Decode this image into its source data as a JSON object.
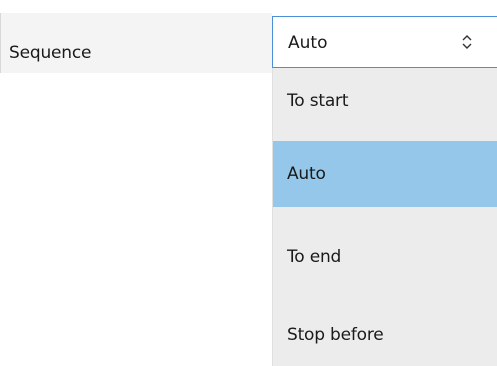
{
  "property": {
    "label": "Sequence"
  },
  "select": {
    "current_value": "Auto",
    "arrow_icon": "updown-chevron-icon"
  },
  "dropdown": {
    "options": [
      {
        "label": "To start",
        "selected": false
      },
      {
        "label": "Auto",
        "selected": true
      },
      {
        "label": "To end",
        "selected": false
      },
      {
        "label": "Stop before",
        "selected": false
      }
    ]
  },
  "colors": {
    "selected_highlight": "#94c7ea",
    "focus_border": "#4a90d9",
    "dropdown_background": "#ececec"
  }
}
